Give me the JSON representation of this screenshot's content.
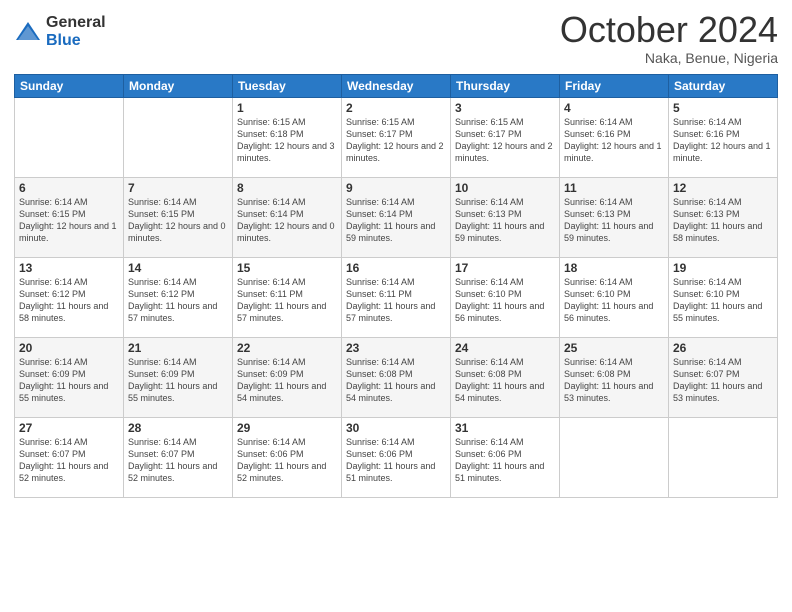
{
  "logo": {
    "general": "General",
    "blue": "Blue"
  },
  "header": {
    "month": "October 2024",
    "location": "Naka, Benue, Nigeria"
  },
  "weekdays": [
    "Sunday",
    "Monday",
    "Tuesday",
    "Wednesday",
    "Thursday",
    "Friday",
    "Saturday"
  ],
  "weeks": [
    [
      {
        "day": "",
        "sunrise": "",
        "sunset": "",
        "daylight": ""
      },
      {
        "day": "",
        "sunrise": "",
        "sunset": "",
        "daylight": ""
      },
      {
        "day": "1",
        "sunrise": "Sunrise: 6:15 AM",
        "sunset": "Sunset: 6:18 PM",
        "daylight": "Daylight: 12 hours and 3 minutes."
      },
      {
        "day": "2",
        "sunrise": "Sunrise: 6:15 AM",
        "sunset": "Sunset: 6:17 PM",
        "daylight": "Daylight: 12 hours and 2 minutes."
      },
      {
        "day": "3",
        "sunrise": "Sunrise: 6:15 AM",
        "sunset": "Sunset: 6:17 PM",
        "daylight": "Daylight: 12 hours and 2 minutes."
      },
      {
        "day": "4",
        "sunrise": "Sunrise: 6:14 AM",
        "sunset": "Sunset: 6:16 PM",
        "daylight": "Daylight: 12 hours and 1 minute."
      },
      {
        "day": "5",
        "sunrise": "Sunrise: 6:14 AM",
        "sunset": "Sunset: 6:16 PM",
        "daylight": "Daylight: 12 hours and 1 minute."
      }
    ],
    [
      {
        "day": "6",
        "sunrise": "Sunrise: 6:14 AM",
        "sunset": "Sunset: 6:15 PM",
        "daylight": "Daylight: 12 hours and 1 minute."
      },
      {
        "day": "7",
        "sunrise": "Sunrise: 6:14 AM",
        "sunset": "Sunset: 6:15 PM",
        "daylight": "Daylight: 12 hours and 0 minutes."
      },
      {
        "day": "8",
        "sunrise": "Sunrise: 6:14 AM",
        "sunset": "Sunset: 6:14 PM",
        "daylight": "Daylight: 12 hours and 0 minutes."
      },
      {
        "day": "9",
        "sunrise": "Sunrise: 6:14 AM",
        "sunset": "Sunset: 6:14 PM",
        "daylight": "Daylight: 11 hours and 59 minutes."
      },
      {
        "day": "10",
        "sunrise": "Sunrise: 6:14 AM",
        "sunset": "Sunset: 6:13 PM",
        "daylight": "Daylight: 11 hours and 59 minutes."
      },
      {
        "day": "11",
        "sunrise": "Sunrise: 6:14 AM",
        "sunset": "Sunset: 6:13 PM",
        "daylight": "Daylight: 11 hours and 59 minutes."
      },
      {
        "day": "12",
        "sunrise": "Sunrise: 6:14 AM",
        "sunset": "Sunset: 6:13 PM",
        "daylight": "Daylight: 11 hours and 58 minutes."
      }
    ],
    [
      {
        "day": "13",
        "sunrise": "Sunrise: 6:14 AM",
        "sunset": "Sunset: 6:12 PM",
        "daylight": "Daylight: 11 hours and 58 minutes."
      },
      {
        "day": "14",
        "sunrise": "Sunrise: 6:14 AM",
        "sunset": "Sunset: 6:12 PM",
        "daylight": "Daylight: 11 hours and 57 minutes."
      },
      {
        "day": "15",
        "sunrise": "Sunrise: 6:14 AM",
        "sunset": "Sunset: 6:11 PM",
        "daylight": "Daylight: 11 hours and 57 minutes."
      },
      {
        "day": "16",
        "sunrise": "Sunrise: 6:14 AM",
        "sunset": "Sunset: 6:11 PM",
        "daylight": "Daylight: 11 hours and 57 minutes."
      },
      {
        "day": "17",
        "sunrise": "Sunrise: 6:14 AM",
        "sunset": "Sunset: 6:10 PM",
        "daylight": "Daylight: 11 hours and 56 minutes."
      },
      {
        "day": "18",
        "sunrise": "Sunrise: 6:14 AM",
        "sunset": "Sunset: 6:10 PM",
        "daylight": "Daylight: 11 hours and 56 minutes."
      },
      {
        "day": "19",
        "sunrise": "Sunrise: 6:14 AM",
        "sunset": "Sunset: 6:10 PM",
        "daylight": "Daylight: 11 hours and 55 minutes."
      }
    ],
    [
      {
        "day": "20",
        "sunrise": "Sunrise: 6:14 AM",
        "sunset": "Sunset: 6:09 PM",
        "daylight": "Daylight: 11 hours and 55 minutes."
      },
      {
        "day": "21",
        "sunrise": "Sunrise: 6:14 AM",
        "sunset": "Sunset: 6:09 PM",
        "daylight": "Daylight: 11 hours and 55 minutes."
      },
      {
        "day": "22",
        "sunrise": "Sunrise: 6:14 AM",
        "sunset": "Sunset: 6:09 PM",
        "daylight": "Daylight: 11 hours and 54 minutes."
      },
      {
        "day": "23",
        "sunrise": "Sunrise: 6:14 AM",
        "sunset": "Sunset: 6:08 PM",
        "daylight": "Daylight: 11 hours and 54 minutes."
      },
      {
        "day": "24",
        "sunrise": "Sunrise: 6:14 AM",
        "sunset": "Sunset: 6:08 PM",
        "daylight": "Daylight: 11 hours and 54 minutes."
      },
      {
        "day": "25",
        "sunrise": "Sunrise: 6:14 AM",
        "sunset": "Sunset: 6:08 PM",
        "daylight": "Daylight: 11 hours and 53 minutes."
      },
      {
        "day": "26",
        "sunrise": "Sunrise: 6:14 AM",
        "sunset": "Sunset: 6:07 PM",
        "daylight": "Daylight: 11 hours and 53 minutes."
      }
    ],
    [
      {
        "day": "27",
        "sunrise": "Sunrise: 6:14 AM",
        "sunset": "Sunset: 6:07 PM",
        "daylight": "Daylight: 11 hours and 52 minutes."
      },
      {
        "day": "28",
        "sunrise": "Sunrise: 6:14 AM",
        "sunset": "Sunset: 6:07 PM",
        "daylight": "Daylight: 11 hours and 52 minutes."
      },
      {
        "day": "29",
        "sunrise": "Sunrise: 6:14 AM",
        "sunset": "Sunset: 6:06 PM",
        "daylight": "Daylight: 11 hours and 52 minutes."
      },
      {
        "day": "30",
        "sunrise": "Sunrise: 6:14 AM",
        "sunset": "Sunset: 6:06 PM",
        "daylight": "Daylight: 11 hours and 51 minutes."
      },
      {
        "day": "31",
        "sunrise": "Sunrise: 6:14 AM",
        "sunset": "Sunset: 6:06 PM",
        "daylight": "Daylight: 11 hours and 51 minutes."
      },
      {
        "day": "",
        "sunrise": "",
        "sunset": "",
        "daylight": ""
      },
      {
        "day": "",
        "sunrise": "",
        "sunset": "",
        "daylight": ""
      }
    ]
  ]
}
